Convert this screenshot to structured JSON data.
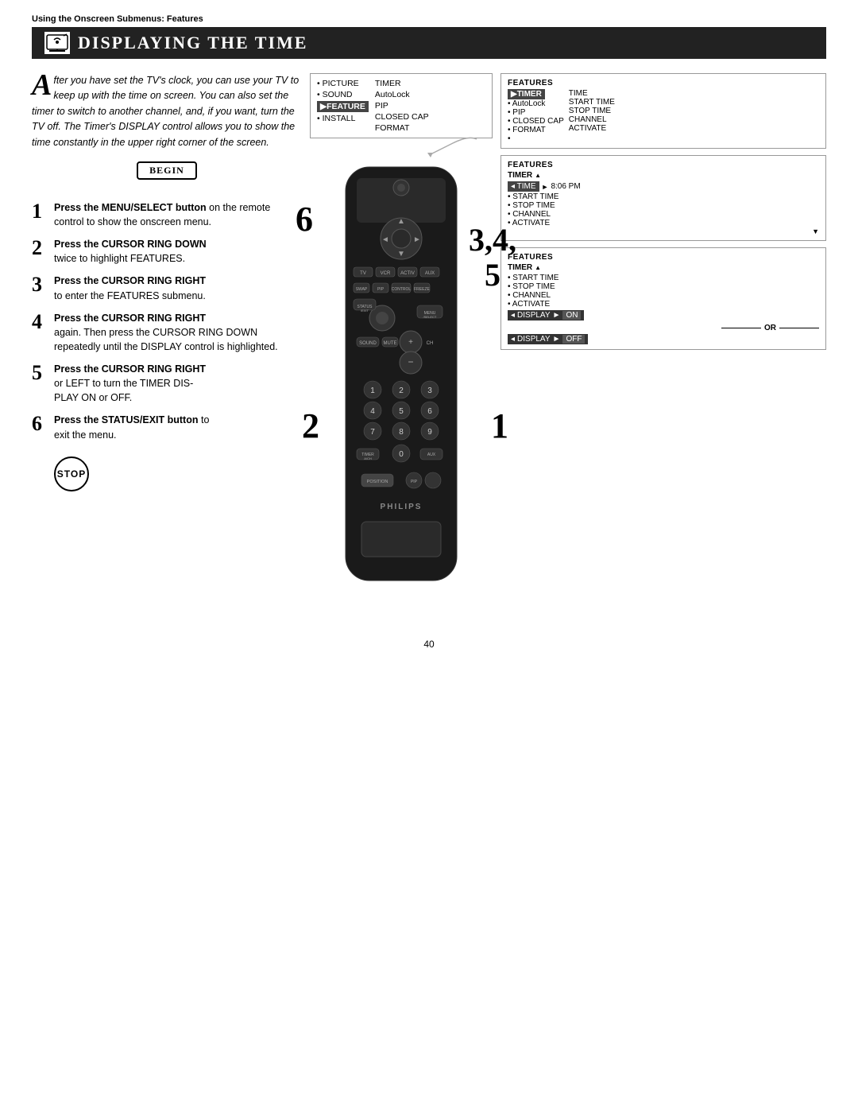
{
  "header": {
    "subheader": "Using the Onscreen Submenus: Features",
    "title": "Displaying the Time",
    "title_display": "DISPLAYING THE TIME"
  },
  "intro": {
    "text1": "fter you have set the TV's clock, you can use your TV to keep up with the time on screen. You can also set the timer to switch to another channel, and, if you want, turn the TV off. The Timer's DISPLAY control allows you to show the time constantly in the upper right corner of the screen.",
    "drop_cap": "A"
  },
  "begin_label": "BEGIN",
  "steps": [
    {
      "number": "1",
      "title": "Press the MENU/SELECT button",
      "body": "on the remote control to show the onscreen menu."
    },
    {
      "number": "2",
      "title": "Press the CURSOR RING DOWN",
      "body": "twice to highlight FEATURES."
    },
    {
      "number": "3",
      "title": "Press the CURSOR RING RIGHT",
      "body": "to enter the FEATURES submenu."
    },
    {
      "number": "4",
      "title": "Press the CURSOR RING RIGHT",
      "body": "again. Then press the CURSOR RING DOWN repeatedly until the DISPLAY control is highlighted."
    },
    {
      "number": "5",
      "title": "Press the CURSOR RING RIGHT",
      "body1": "or LEFT to turn the TIMER DIS-",
      "body2": "PLAY ON or OFF."
    },
    {
      "number": "6",
      "title": "Press the STATUS/EXIT button",
      "title_suffix": " to",
      "body": "exit the menu."
    }
  ],
  "stop_label": "STOP",
  "menu_box1": {
    "col1": [
      {
        "text": "• PICTURE",
        "bullet": true
      },
      {
        "text": "• SOUND",
        "bullet": true
      },
      {
        "text": "FEATURE",
        "highlighted": true
      },
      {
        "text": "• INSTALL",
        "bullet": true
      }
    ],
    "col2": [
      {
        "text": "TIMER"
      },
      {
        "text": "AutoLock"
      },
      {
        "text": "PIP"
      },
      {
        "text": "CLOSED CAP"
      },
      {
        "text": "FORMAT"
      }
    ]
  },
  "panel1": {
    "title": "FEATURES",
    "items": [
      {
        "text": "TIMER",
        "highlighted": true,
        "suffix": "TIME"
      },
      {
        "text": "• AutoLock",
        "suffix": "START TIME"
      },
      {
        "text": "• PIP",
        "suffix": "STOP TIME"
      },
      {
        "text": "• CLOSED CAP",
        "suffix": "CHANNEL"
      },
      {
        "text": "• FORMAT",
        "suffix": "ACTIVATE"
      },
      {
        "text": "•"
      }
    ]
  },
  "panel2": {
    "title": "FEATURES",
    "subtitle": "TIMER",
    "items": [
      {
        "text": "TIME",
        "highlighted": true,
        "value": "8:06 PM"
      },
      {
        "text": "• START TIME"
      },
      {
        "text": "• STOP TIME"
      },
      {
        "text": "• CHANNEL"
      },
      {
        "text": "• ACTIVATE"
      },
      {
        "text": "•",
        "arrow_down": true
      }
    ]
  },
  "panel3": {
    "title": "FEATURES",
    "subtitle": "TIMER",
    "items": [
      {
        "text": "• START TIME"
      },
      {
        "text": "• STOP TIME"
      },
      {
        "text": "• CHANNEL"
      },
      {
        "text": "• ACTIVATE"
      }
    ],
    "display_row": {
      "label": "DISPLAY",
      "arrow": "◄►",
      "value": "ON"
    },
    "or_label": "OR",
    "display_row2": {
      "label": "DISPLAY",
      "arrow": "◄►",
      "value": "OFF"
    }
  },
  "page_number": "40",
  "step_numbers_overlay": [
    "6",
    "3,4,\n5",
    "2",
    "1"
  ],
  "philips_label": "PHILIPS"
}
